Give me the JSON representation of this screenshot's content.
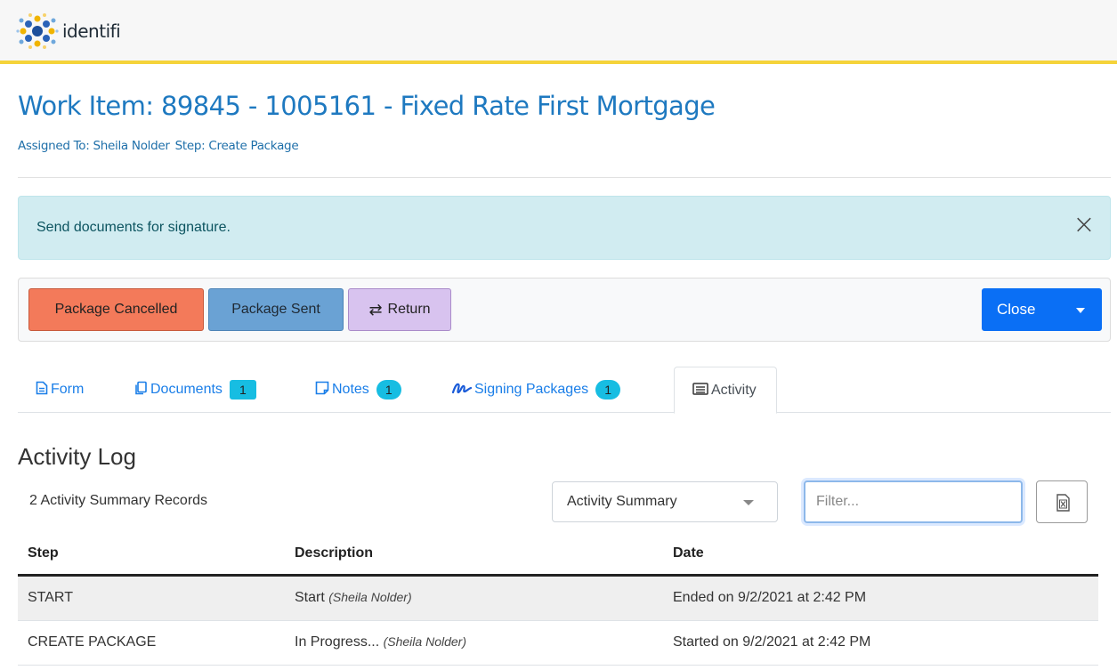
{
  "app": {
    "logo_text": "identifi"
  },
  "work_item": {
    "title": "Work Item: 89845 - 1005161 - Fixed Rate First Mortgage",
    "assigned_to": "Assigned To: Sheila Nolder",
    "step": "Step: Create Package"
  },
  "alert": {
    "message": "Send documents for signature.",
    "close_icon": "close-x"
  },
  "toolbar": {
    "package_cancelled": "Package Cancelled",
    "package_sent": "Package Sent",
    "return": "Return",
    "close": "Close"
  },
  "tabs": [
    {
      "label": "Form",
      "icon": "file-icon"
    },
    {
      "label": "Documents",
      "icon": "copy-icon",
      "badge": "1"
    },
    {
      "label": "Notes",
      "icon": "note-icon",
      "badge": "1"
    },
    {
      "label": "Signing Packages",
      "icon": "signature-icon",
      "badge": "1"
    },
    {
      "label": "Activity",
      "icon": "list-icon",
      "active": true
    }
  ],
  "activity": {
    "heading": "Activity Log",
    "records": "2 Activity Summary Records",
    "view_select": "Activity Summary",
    "filter_placeholder": "Filter...",
    "export_icon": "excel-icon",
    "columns": [
      "Step",
      "Description",
      "Date"
    ],
    "rows": [
      {
        "step": "START",
        "description": "Start",
        "by": "(Sheila Nolder)",
        "date": "Ended on 9/2/2021 at 2:42 PM"
      },
      {
        "step": "CREATE PACKAGE",
        "description": "In Progress...",
        "by": "(Sheila Nolder)",
        "date": "Started on 9/2/2021 at 2:42 PM"
      }
    ]
  },
  "colors": {
    "brand_blue": "#1e79c0",
    "accent_yellow": "#f5d33a",
    "cancel": "#f37a5a",
    "sent": "#6aa2d4",
    "return": "#d8c3ef",
    "close": "#0a6ff5",
    "badge": "#17bde2"
  }
}
